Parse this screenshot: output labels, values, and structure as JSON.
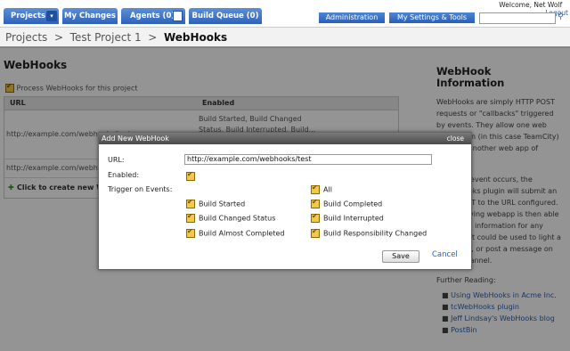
{
  "nav": {
    "projects": "Projects",
    "projects_dd": "▾",
    "my_changes": "My Changes",
    "agents": "Agents (0)",
    "build_queue": "Build Queue (0)",
    "administration": "Administration",
    "my_settings": "My Settings & Tools",
    "welcome": "Welcome, Net Wolf",
    "logout": "Logout"
  },
  "breadcrumb": {
    "root": "Projects",
    "project": "Test Project 1",
    "page": "WebHooks"
  },
  "main": {
    "title": "WebHooks",
    "process_label": "Process WebHooks for this project",
    "col_url": "URL",
    "col_enabled": "Enabled",
    "row1_url": "http://example.com/webhooks/test",
    "row1_events": "Build Started, Build Changed Status, Build Interrupted, Build...",
    "row2_url": "http://example.com/webhooks/test",
    "create_link": "Click to create new WebHook"
  },
  "sidebar": {
    "title": "WebHook Information",
    "para1": "WebHooks are simply HTTP POST requests or \"callbacks\" triggered by events. They allow one web application (in this case TeamCity) to notify another web app of events.",
    "para2": "When an event occurs, the tcWebHooks plugin will submit an HTTP POST to the URL configured. The receiving webapp is then able to use the information for any purpose. It could be used to light a lava lamp, or post a message on an IRC channel.",
    "reading": "Further Reading:",
    "links": [
      "Using WebHooks in Acme Inc.",
      "tcWebHooks plugin",
      "Jeff Lindsay's WebHooks blog",
      "PostBin"
    ]
  },
  "modal": {
    "title": "Add New WebHook",
    "close": "close",
    "url_label": "URL:",
    "url_value": "http://example.com/webhooks/test",
    "enabled_label": "Enabled:",
    "trigger_label": "Trigger on Events:",
    "events": {
      "build_started": "Build Started",
      "build_changed_status": "Build Changed Status",
      "build_almost_completed": "Build Almost Completed",
      "all": "All",
      "build_completed": "Build Completed",
      "build_interrupted": "Build Interrupted",
      "build_responsibility_changed": "Build Responsibility Changed"
    },
    "save": "Save",
    "cancel": "Cancel"
  }
}
